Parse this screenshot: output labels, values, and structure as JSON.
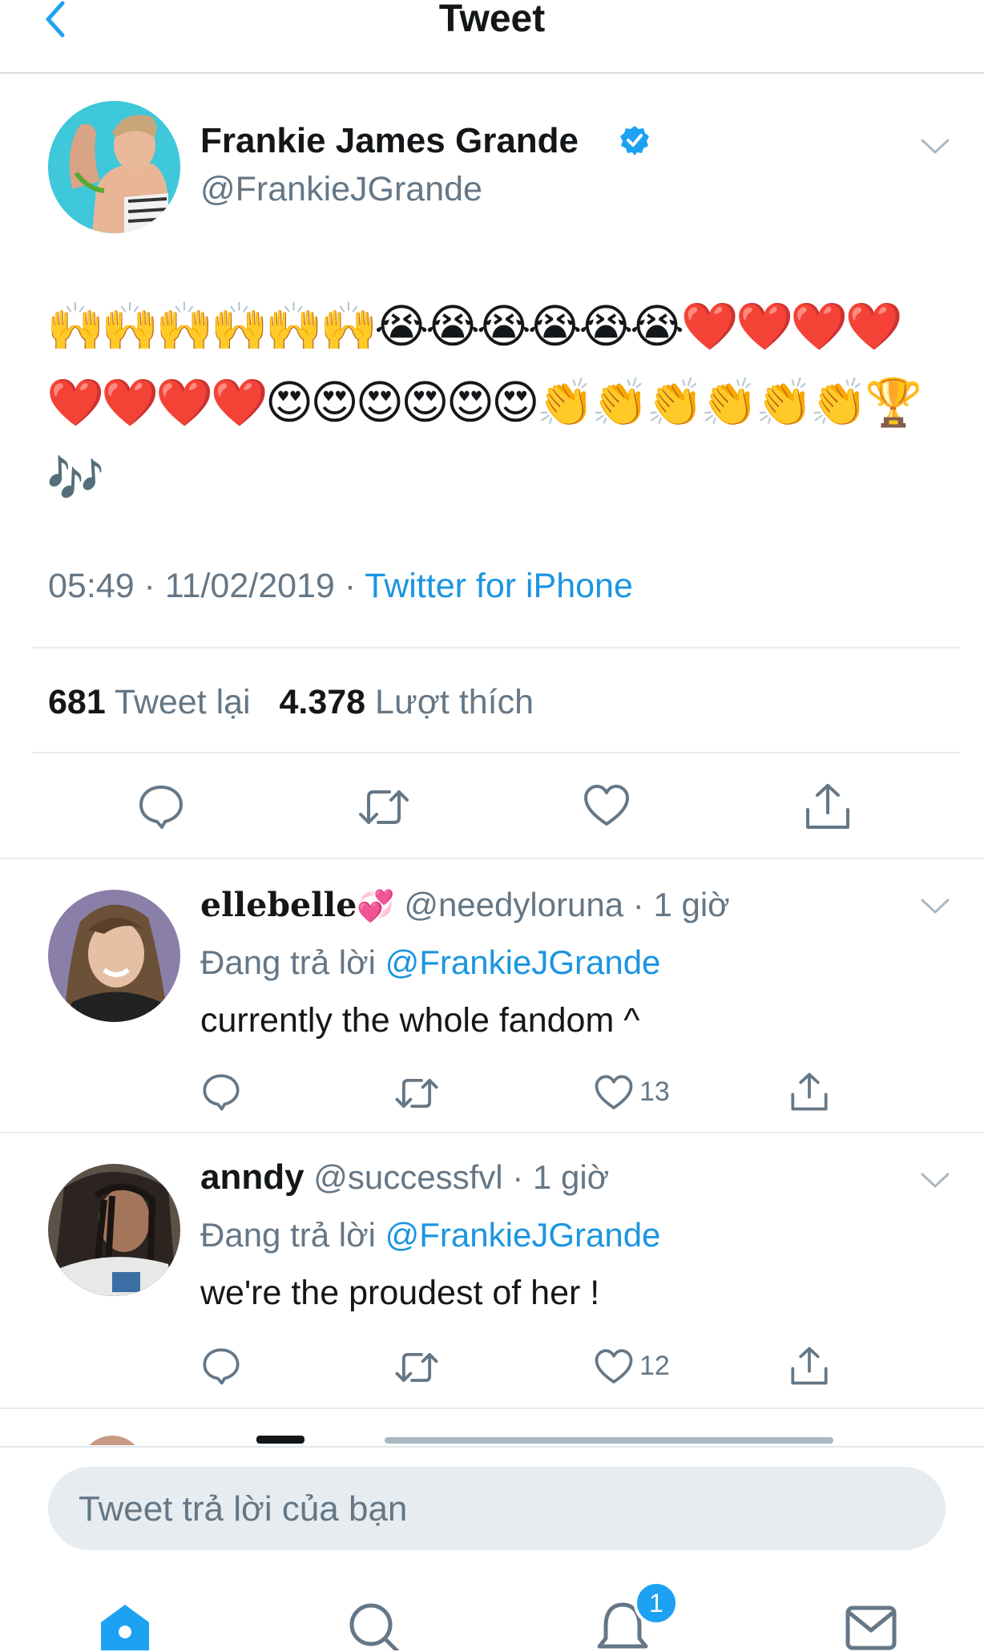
{
  "header": {
    "title": "Tweet"
  },
  "tweet": {
    "author_name": "Frankie James Grande",
    "author_handle": "@FrankieJGrande",
    "emoji_content": "🙌🙌🙌🙌🙌🙌😭😭😭😭😭😭❤️❤️❤️❤️❤️❤️❤️❤️😍😍😍😍😍😍👏👏👏👏👏👏🏆🎶",
    "time": "05:49",
    "date": "11/02/2019",
    "source": "Twitter for iPhone",
    "retweet_count": "681",
    "retweet_label": "Tweet lại",
    "like_count": "4.378",
    "like_label": "Lượt thích"
  },
  "replies": [
    {
      "name": "ellebelle",
      "name_emoji": "💞",
      "handle": "@needyloruna",
      "time": "1 giờ",
      "replying_prefix": "Đang trả lời",
      "replying_to": "@FrankieJGrande",
      "text": "currently the whole fandom ^",
      "likes": "13"
    },
    {
      "name": "anndy",
      "handle": "@successfvl",
      "time": "1 giờ",
      "replying_prefix": "Đang trả lời",
      "replying_to": "@FrankieJGrande",
      "text": "we're the proudest of her !",
      "likes": "12"
    }
  ],
  "composer": {
    "placeholder": "Tweet trả lời của bạn"
  },
  "tabbar": {
    "notification_badge": "1"
  },
  "colors": {
    "accent": "#1da1f2",
    "link": "#1b95e0",
    "muted": "#657786",
    "divider": "#e6ecf0"
  },
  "icons": [
    "back-chevron-icon",
    "verified-badge-icon",
    "chevron-down-icon",
    "reply-icon",
    "retweet-icon",
    "like-icon",
    "share-icon",
    "home-icon",
    "search-icon",
    "notifications-icon",
    "messages-icon"
  ]
}
